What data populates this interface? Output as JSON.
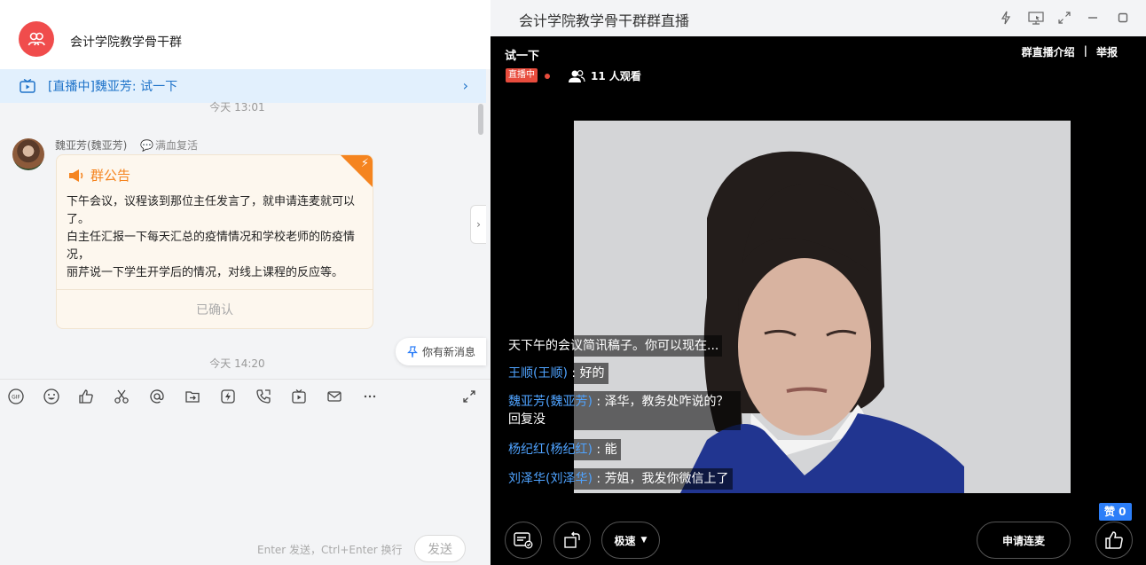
{
  "chat": {
    "group_name": "会计学院教学骨干群",
    "live_banner": "[直播中]魏亚芳: 试一下",
    "times": [
      "今天 13:01",
      "今天 14:20"
    ],
    "sender": {
      "name": "魏亚芳(魏亚芳)",
      "tag": "满血复活"
    },
    "notice": {
      "title": "群公告",
      "lines": [
        "下午会议，议程该到那位主任发言了，就申请连麦就可以了。",
        "白主任汇报一下每天汇总的疫情情况和学校老师的防疫情况，",
        "丽芹说一下学生开学后的情况，对线上课程的反应等。"
      ],
      "confirm": "已确认"
    },
    "new_message": "你有新消息",
    "send_hint": "Enter 发送，Ctrl+Enter 换行",
    "send_label": "发送",
    "toolbar_icons": [
      "gif-icon",
      "emoji-icon",
      "thumbs-up-icon",
      "scissors-icon",
      "at-icon",
      "forward-icon",
      "flash-icon",
      "phone-icon",
      "live-icon",
      "mail-icon",
      "more-icon"
    ]
  },
  "live": {
    "window_title": "会计学院教学骨干群群直播",
    "stream_title": "试一下",
    "intro_link": "群直播介绍",
    "separator": "|",
    "report_link": "举报",
    "live_badge": "直播中",
    "viewers": "11 人观看",
    "danmu": [
      {
        "who": "",
        "text": "天下午的会议简讯稿子。你可以现在..."
      },
      {
        "who": "王顺(王顺)",
        "text": "好的"
      },
      {
        "who": "魏亚芳(魏亚芳)",
        "text": "泽华，教务处咋说的？回复没"
      },
      {
        "who": "杨纪红(杨纪红)",
        "text": "能"
      },
      {
        "who": "刘泽华(刘泽华)",
        "text": "芳姐，我发你微信上了"
      }
    ],
    "speed_label": "极速",
    "apply_label": "申请连麦",
    "like_label": "赞 0"
  },
  "colors": {
    "accent_blue": "#1f73c9",
    "live_red": "#e84c3d",
    "notice_orange": "#f5841f",
    "like_blue": "#2c7ef8"
  }
}
